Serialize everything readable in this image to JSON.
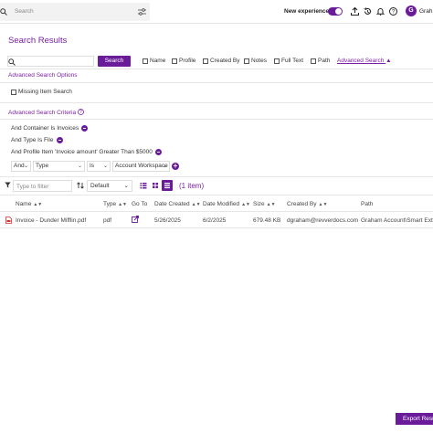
{
  "topbar": {
    "search_placeholder": "Search",
    "new_experience_label": "New experience",
    "avatar_initial": "G",
    "user_name": "Grah"
  },
  "page": {
    "title": "Search Results"
  },
  "search": {
    "button_label": "Search",
    "options": [
      "Name",
      "Profile",
      "Created By",
      "Notes",
      "Full Text",
      "Path"
    ],
    "advanced_link": "Advanced Search"
  },
  "advanced_options": {
    "title": "Advanced Search Options",
    "missing_item_label": "Missing Item Search"
  },
  "advanced_criteria": {
    "title": "Advanced Search Criteria",
    "criteria": [
      "And Container Is Invoices",
      "And Type Is File",
      "And Profile Item 'Invoice amount' Greater Than $5000"
    ],
    "builder": {
      "conjunction": "And",
      "field": "Type",
      "operator": "Is",
      "value": "Account Workspace"
    }
  },
  "toolbar": {
    "filter_placeholder": "Type to filter",
    "view_option": "Default",
    "item_count": "(1 item)"
  },
  "table": {
    "headers": [
      "Name",
      "Type",
      "Go To",
      "Date Created",
      "Date Modified",
      "Size",
      "Created By",
      "Path"
    ],
    "rows": [
      {
        "name": "Invoice - Dunder Mifflin.pdf",
        "type": "pdf",
        "date_created": "5/26/2025",
        "date_modified": "6/2/2025",
        "size": "679.48 KB",
        "created_by": "dgraham@revverdocs.com",
        "path": "Graham Account\\Smart Extra"
      }
    ]
  },
  "export_button": "Export Resu",
  "colors": {
    "accent": "#6a1b9a",
    "link": "#7b1fa2"
  }
}
